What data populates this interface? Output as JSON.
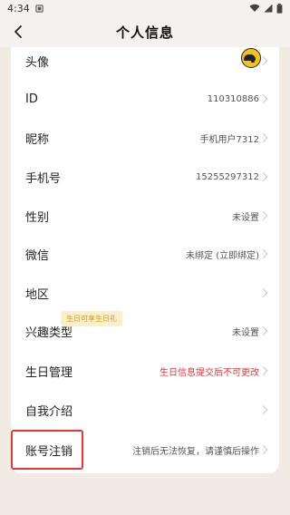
{
  "status_bar": {
    "time": "4:34",
    "icons": [
      "notification-icon",
      "wifi-icon",
      "signal-icon",
      "battery-icon"
    ]
  },
  "header": {
    "title": "个人信息",
    "back_icon": "chevron-left-icon"
  },
  "rows": {
    "avatar": {
      "label": "头像",
      "value": ""
    },
    "id": {
      "label": "ID",
      "value": "110310886"
    },
    "nickname": {
      "label": "昵称",
      "value": "手机用户7312"
    },
    "phone": {
      "label": "手机号",
      "value": "15255297312"
    },
    "gender": {
      "label": "性别",
      "value": "未设置"
    },
    "wechat": {
      "label": "微信",
      "value": "未绑定 (立即绑定)"
    },
    "region": {
      "label": "地区",
      "value": ""
    },
    "interest": {
      "label": "兴趣类型",
      "value": "未设置"
    },
    "birthday": {
      "label": "生日管理",
      "badge": "生日可享生日礼",
      "value": "生日信息提交后不可更改"
    },
    "bio": {
      "label": "自我介绍",
      "value": ""
    },
    "cancel_account": {
      "label": "账号注销",
      "value": "注销后无法恢复，请谨慎后操作"
    }
  },
  "colors": {
    "background": "#f1ebe3",
    "card": "#ffffff",
    "warning_text": "#e0383b",
    "badge_bg": "#fcefc9",
    "badge_text": "#d89c1c",
    "highlight_border": "#e53935"
  }
}
